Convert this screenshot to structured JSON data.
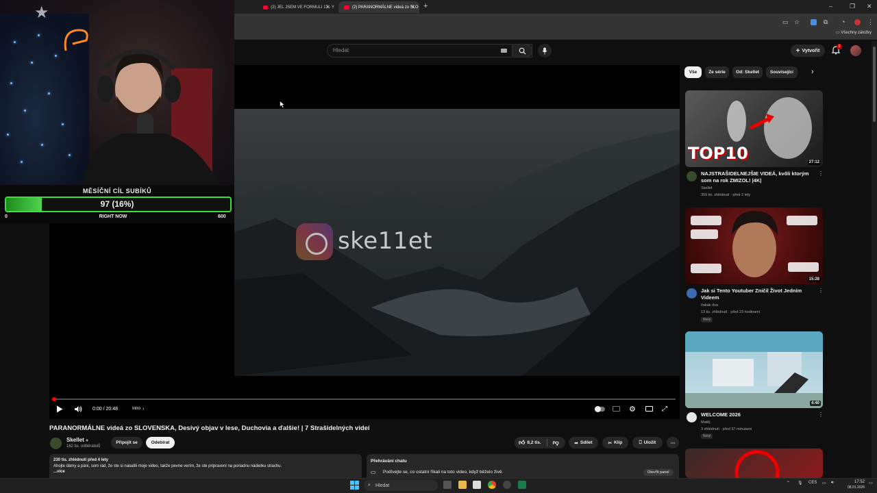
{
  "browser": {
    "tabs": [
      {
        "label": "(2) JEL JSEM VE FORMULI 17 - Y",
        "active": false
      },
      {
        "label": "(2) PARANORMÁLNE videá zo SLO",
        "active": true
      }
    ],
    "new_tab": "+",
    "window_controls": {
      "minimize": "–",
      "maximize": "❐",
      "close": "✕"
    },
    "bookmarks_all": "Všechny záložky"
  },
  "youtube": {
    "search_placeholder": "Hledat",
    "create_label": "Vytvořit",
    "notifications_count": "2"
  },
  "player": {
    "time": "0:00 / 20:48",
    "chapter": "Intro",
    "progress_fraction": 0.0,
    "watermark_handle": "ske11et"
  },
  "stream_overlay": {
    "goal_title": "MĚSÍČNÍ CÍL SUBÍKŮ",
    "goal_value": "97 (16%)",
    "goal_fraction": 0.16,
    "goal_min": "0",
    "goal_label": "RIGHT NOW",
    "goal_max": "600"
  },
  "video": {
    "title": "PARANORMÁLNE videá zo SLOVENSKA, Desivý objav v lese, Duchovia a ďalšie! | 7 Strašidelných videí",
    "channel": "Skellet",
    "subscribers": "162 tis. odběratelů",
    "join_label": "Připojit se",
    "subscribe_label": "Odebírat",
    "likes": "8,2 tis.",
    "share_label": "Sdílet",
    "clip_label": "Klip",
    "save_label": "Uložit",
    "more": "⋯",
    "views_date": "230 tis. zhlédnutí  před 4 lety",
    "description": "Ahojte dámy a páni, som rád, že ste si naladili moje video, takže pevne verím, že ste pripravení na poriadnu nádielku strachu.",
    "more_label": "...více"
  },
  "chat_replay": {
    "title": "Přehrávání chatu",
    "text": "Podívejte se, co ostatní říkali na toto video, když běželo živě.",
    "open_label": "Otevřít panel"
  },
  "sidebar": {
    "chips": [
      "Vše",
      "Ze série",
      "Od: Skellet",
      "Související"
    ],
    "recommendations": [
      {
        "title": "NAJSTRAŠIDELNEJŠIE VIDEÁ, kvôli ktorým som na rok ZMIZOL! |4K|",
        "channel": "Skellet",
        "meta": "359 tis. zhlédnutí · před 2 lety",
        "duration": "27:12",
        "badge": "",
        "thumb_text": "TOP10"
      },
      {
        "title": "Jak si Tento Youtuber Zničil Život Jedním Videem",
        "channel": "žabák dva",
        "meta": "13 tis. zhlédnutí · před 23 hodinami",
        "duration": "15:28",
        "badge": "Nový",
        "thumb_text": ""
      },
      {
        "title": "WELCOME 2026",
        "channel": "Matěj",
        "meta": "3 zhlédnutí · před 37 minutami",
        "duration": "4:40",
        "badge": "Nový",
        "thumb_text": ""
      }
    ]
  },
  "taskbar": {
    "search_label": "Hledat",
    "language": "CES",
    "time": "17:52",
    "date": "08.01.2026"
  },
  "colors": {
    "accent": "#ff0033",
    "goal_green": "#3ee03e",
    "bg": "#0f0f0f"
  }
}
